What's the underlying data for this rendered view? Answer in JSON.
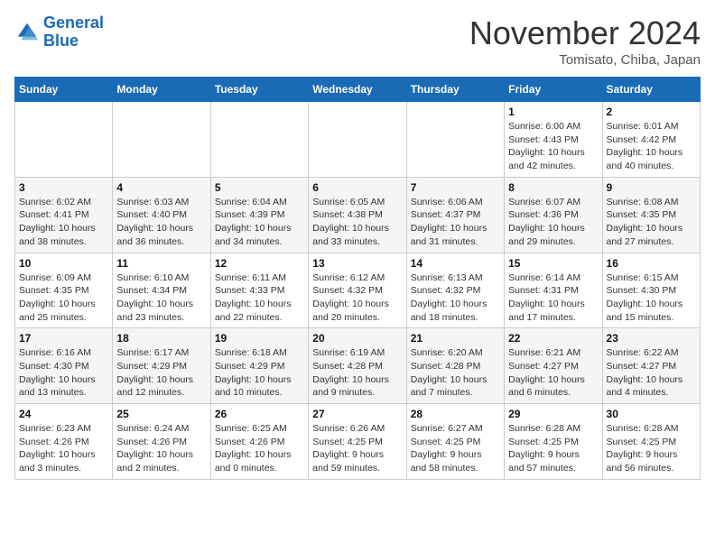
{
  "header": {
    "logo_line1": "General",
    "logo_line2": "Blue",
    "month_title": "November 2024",
    "location": "Tomisato, Chiba, Japan"
  },
  "days_of_week": [
    "Sunday",
    "Monday",
    "Tuesday",
    "Wednesday",
    "Thursday",
    "Friday",
    "Saturday"
  ],
  "weeks": [
    [
      {
        "day": "",
        "info": ""
      },
      {
        "day": "",
        "info": ""
      },
      {
        "day": "",
        "info": ""
      },
      {
        "day": "",
        "info": ""
      },
      {
        "day": "",
        "info": ""
      },
      {
        "day": "1",
        "info": "Sunrise: 6:00 AM\nSunset: 4:43 PM\nDaylight: 10 hours\nand 42 minutes."
      },
      {
        "day": "2",
        "info": "Sunrise: 6:01 AM\nSunset: 4:42 PM\nDaylight: 10 hours\nand 40 minutes."
      }
    ],
    [
      {
        "day": "3",
        "info": "Sunrise: 6:02 AM\nSunset: 4:41 PM\nDaylight: 10 hours\nand 38 minutes."
      },
      {
        "day": "4",
        "info": "Sunrise: 6:03 AM\nSunset: 4:40 PM\nDaylight: 10 hours\nand 36 minutes."
      },
      {
        "day": "5",
        "info": "Sunrise: 6:04 AM\nSunset: 4:39 PM\nDaylight: 10 hours\nand 34 minutes."
      },
      {
        "day": "6",
        "info": "Sunrise: 6:05 AM\nSunset: 4:38 PM\nDaylight: 10 hours\nand 33 minutes."
      },
      {
        "day": "7",
        "info": "Sunrise: 6:06 AM\nSunset: 4:37 PM\nDaylight: 10 hours\nand 31 minutes."
      },
      {
        "day": "8",
        "info": "Sunrise: 6:07 AM\nSunset: 4:36 PM\nDaylight: 10 hours\nand 29 minutes."
      },
      {
        "day": "9",
        "info": "Sunrise: 6:08 AM\nSunset: 4:35 PM\nDaylight: 10 hours\nand 27 minutes."
      }
    ],
    [
      {
        "day": "10",
        "info": "Sunrise: 6:09 AM\nSunset: 4:35 PM\nDaylight: 10 hours\nand 25 minutes."
      },
      {
        "day": "11",
        "info": "Sunrise: 6:10 AM\nSunset: 4:34 PM\nDaylight: 10 hours\nand 23 minutes."
      },
      {
        "day": "12",
        "info": "Sunrise: 6:11 AM\nSunset: 4:33 PM\nDaylight: 10 hours\nand 22 minutes."
      },
      {
        "day": "13",
        "info": "Sunrise: 6:12 AM\nSunset: 4:32 PM\nDaylight: 10 hours\nand 20 minutes."
      },
      {
        "day": "14",
        "info": "Sunrise: 6:13 AM\nSunset: 4:32 PM\nDaylight: 10 hours\nand 18 minutes."
      },
      {
        "day": "15",
        "info": "Sunrise: 6:14 AM\nSunset: 4:31 PM\nDaylight: 10 hours\nand 17 minutes."
      },
      {
        "day": "16",
        "info": "Sunrise: 6:15 AM\nSunset: 4:30 PM\nDaylight: 10 hours\nand 15 minutes."
      }
    ],
    [
      {
        "day": "17",
        "info": "Sunrise: 6:16 AM\nSunset: 4:30 PM\nDaylight: 10 hours\nand 13 minutes."
      },
      {
        "day": "18",
        "info": "Sunrise: 6:17 AM\nSunset: 4:29 PM\nDaylight: 10 hours\nand 12 minutes."
      },
      {
        "day": "19",
        "info": "Sunrise: 6:18 AM\nSunset: 4:29 PM\nDaylight: 10 hours\nand 10 minutes."
      },
      {
        "day": "20",
        "info": "Sunrise: 6:19 AM\nSunset: 4:28 PM\nDaylight: 10 hours\nand 9 minutes."
      },
      {
        "day": "21",
        "info": "Sunrise: 6:20 AM\nSunset: 4:28 PM\nDaylight: 10 hours\nand 7 minutes."
      },
      {
        "day": "22",
        "info": "Sunrise: 6:21 AM\nSunset: 4:27 PM\nDaylight: 10 hours\nand 6 minutes."
      },
      {
        "day": "23",
        "info": "Sunrise: 6:22 AM\nSunset: 4:27 PM\nDaylight: 10 hours\nand 4 minutes."
      }
    ],
    [
      {
        "day": "24",
        "info": "Sunrise: 6:23 AM\nSunset: 4:26 PM\nDaylight: 10 hours\nand 3 minutes."
      },
      {
        "day": "25",
        "info": "Sunrise: 6:24 AM\nSunset: 4:26 PM\nDaylight: 10 hours\nand 2 minutes."
      },
      {
        "day": "26",
        "info": "Sunrise: 6:25 AM\nSunset: 4:26 PM\nDaylight: 10 hours\nand 0 minutes."
      },
      {
        "day": "27",
        "info": "Sunrise: 6:26 AM\nSunset: 4:25 PM\nDaylight: 9 hours\nand 59 minutes."
      },
      {
        "day": "28",
        "info": "Sunrise: 6:27 AM\nSunset: 4:25 PM\nDaylight: 9 hours\nand 58 minutes."
      },
      {
        "day": "29",
        "info": "Sunrise: 6:28 AM\nSunset: 4:25 PM\nDaylight: 9 hours\nand 57 minutes."
      },
      {
        "day": "30",
        "info": "Sunrise: 6:28 AM\nSunset: 4:25 PM\nDaylight: 9 hours\nand 56 minutes."
      }
    ]
  ]
}
